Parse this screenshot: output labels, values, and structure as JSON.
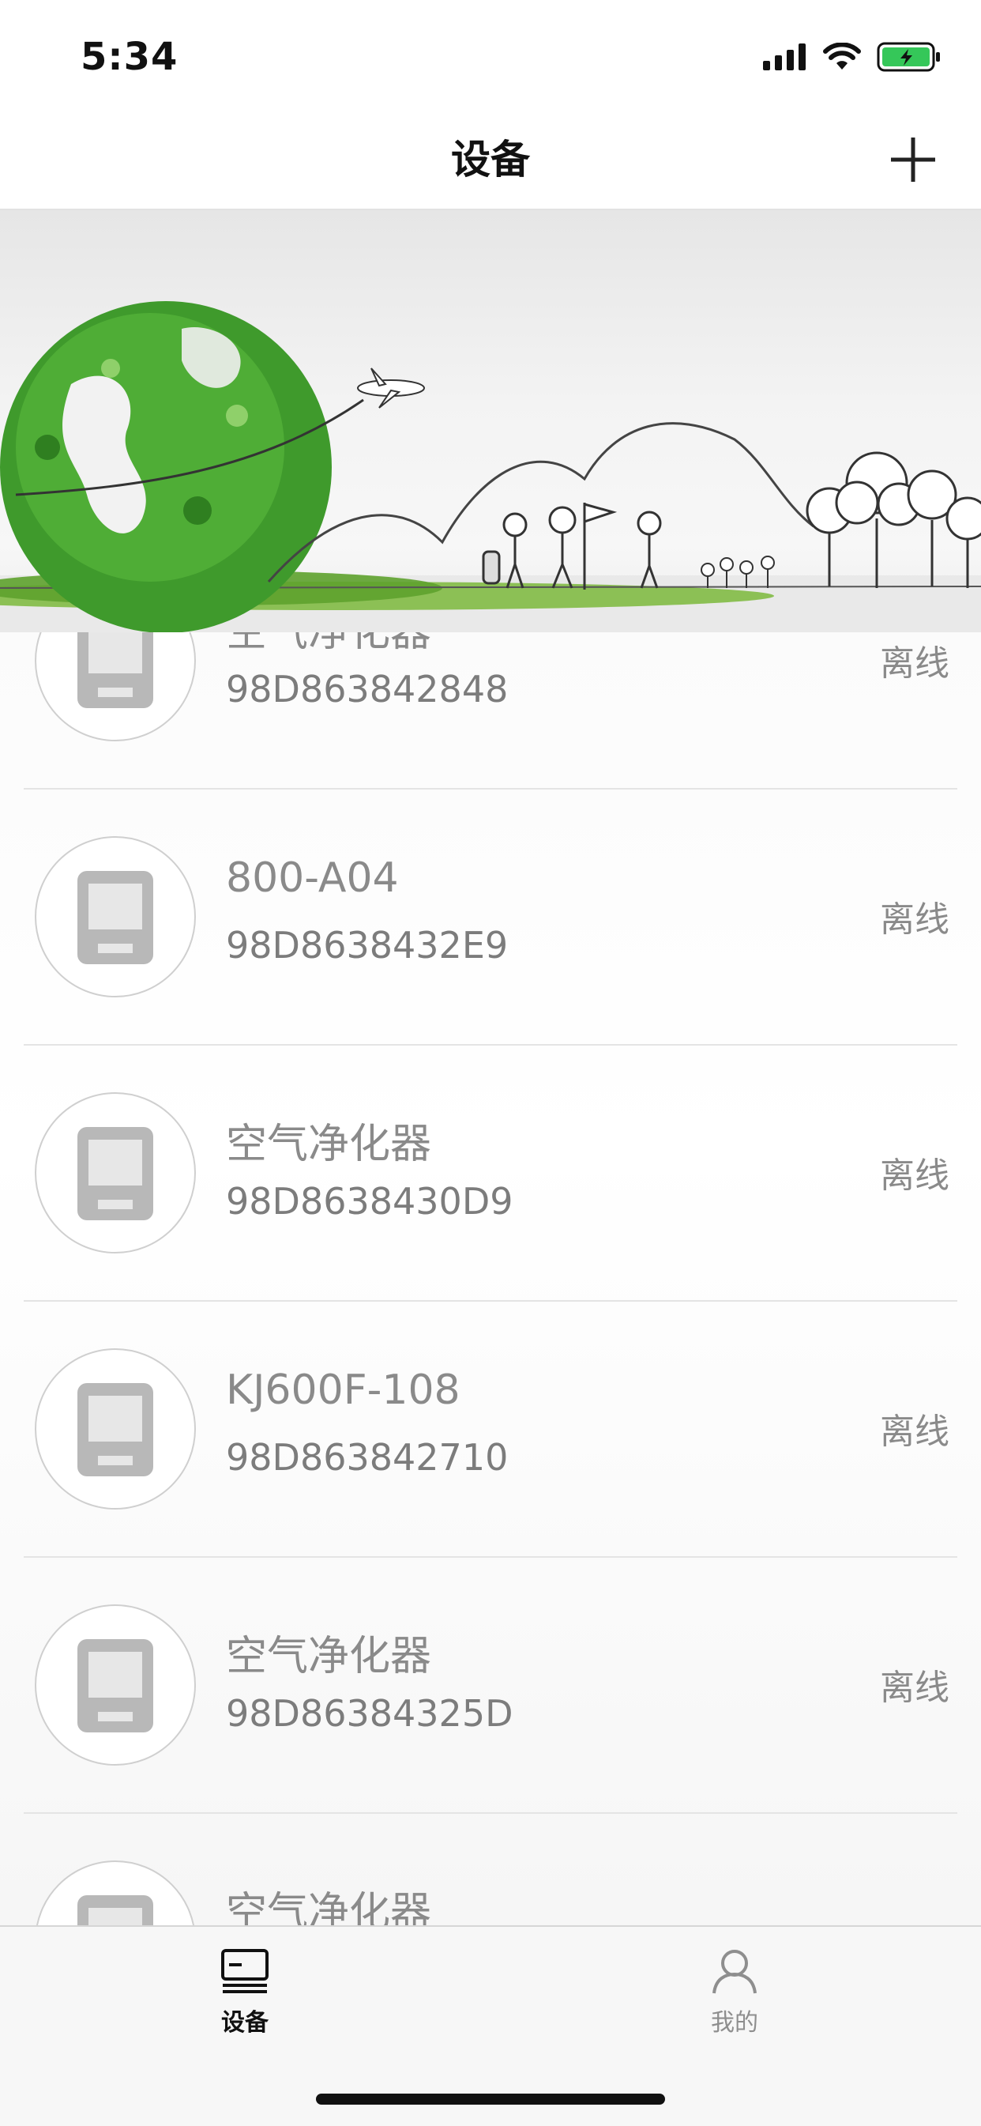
{
  "status_bar": {
    "time": "5:34"
  },
  "nav": {
    "title": "设备"
  },
  "devices": [
    {
      "name": "空气净化器",
      "id": "98D863842848",
      "status": "离线"
    },
    {
      "name": "800-A04",
      "id": "98D8638432E9",
      "status": "离线"
    },
    {
      "name": "空气净化器",
      "id": "98D8638430D9",
      "status": "离线"
    },
    {
      "name": "KJ600F-108",
      "id": "98D863842710",
      "status": "离线"
    },
    {
      "name": "空气净化器",
      "id": "98D86384325D",
      "status": "离线"
    },
    {
      "name": "空气净化器",
      "id": "",
      "status": ""
    }
  ],
  "tabs": [
    {
      "label": "设备",
      "icon": "device-tab-icon",
      "active": true
    },
    {
      "label": "我的",
      "icon": "person-icon",
      "active": false
    }
  ],
  "colors": {
    "battery": "#35c759",
    "text_secondary": "#8a8a8a"
  }
}
